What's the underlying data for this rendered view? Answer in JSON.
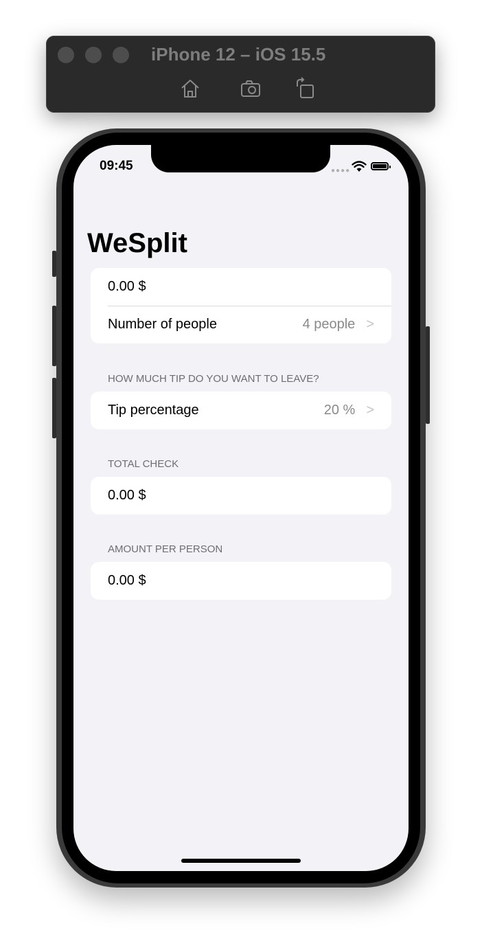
{
  "simulator": {
    "title": "iPhone 12 – iOS 15.5",
    "buttons": [
      "home-icon",
      "screenshot-icon",
      "rotate-icon"
    ]
  },
  "status_bar": {
    "time": "09:45"
  },
  "app": {
    "title": "WeSplit",
    "input_section": {
      "amount": "0.00 $",
      "people_label": "Number of people",
      "people_value": "4 people"
    },
    "tip_section": {
      "header": "HOW MUCH TIP DO YOU WANT TO LEAVE?",
      "label": "Tip percentage",
      "value": "20 %"
    },
    "total_section": {
      "header": "TOTAL CHECK",
      "value": "0.00 $"
    },
    "per_person_section": {
      "header": "AMOUNT PER PERSON",
      "value": "0.00 $"
    }
  },
  "colors": {
    "background": "#f2f2f7",
    "secondary_text": "#8a8a8e",
    "header_text": "#6d6d72"
  }
}
